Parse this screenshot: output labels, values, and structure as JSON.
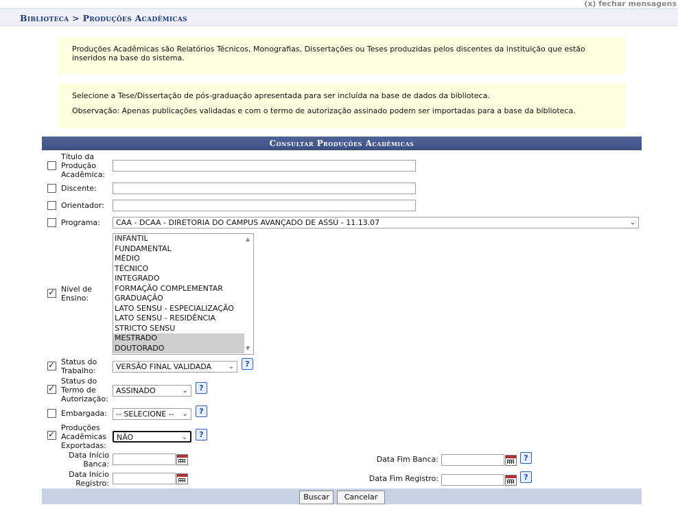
{
  "close_messages": "(x) fechar mensagens",
  "breadcrumb": {
    "root": "Biblioteca",
    "separator": ">",
    "current": "Produções Acadêmicas"
  },
  "info": {
    "paragraph1": "Produções Acadêmicas são Relatórios Técnicos, Monografias, Dissertações ou Teses produzidas pelos discentes da instituição que estão inseridos na base do sistema.",
    "paragraph2": "Selecione a Tese/Dissertação de pós-graduação apresentada para ser incluída na base de dados da biblioteca.",
    "paragraph3": "Observação: Apenas publicações validadas e com o termo de autorização assinado podem ser importadas para a base da biblioteca."
  },
  "form": {
    "caption": "Consultar Produções Acadêmicas",
    "titulo": {
      "label_l1": "Título da",
      "label_l2": "Produção",
      "label_l3": "Acadêmica:",
      "checked": false,
      "value": ""
    },
    "discente": {
      "label": "Discente:",
      "checked": false,
      "value": ""
    },
    "orientador": {
      "label": "Orientador:",
      "checked": false,
      "value": ""
    },
    "programa": {
      "label": "Programa:",
      "checked": false,
      "value": "CAA - DCAA - DIRETORIA DO CAMPUS AVANÇADO DE ASSÚ - 11.13.07"
    },
    "nivel": {
      "label_l1": "Nível de",
      "label_l2": "Ensino:",
      "checked": true,
      "options": [
        "INFANTIL",
        "FUNDAMENTAL",
        "MÉDIO",
        "TÉCNICO",
        "INTEGRADO",
        "FORMAÇÃO COMPLEMENTAR",
        "GRADUAÇÃO",
        "LATO SENSU - ESPECIALIZAÇÃO",
        "LATO SENSU - RESIDÊNCIA",
        "STRICTO SENSU",
        "MESTRADO",
        "DOUTORADO"
      ],
      "selected": [
        "MESTRADO",
        "DOUTORADO"
      ]
    },
    "status": {
      "label_l1": "Status do",
      "label_l2": "Trabalho:",
      "checked": true,
      "value": "VERSÃO FINAL VALIDADA",
      "help": "?"
    },
    "termo": {
      "label_l1": "Status do",
      "label_l2": "Termo de",
      "label_l3": "Autorização:",
      "checked": true,
      "value": "ASSINADO",
      "help": "?"
    },
    "embargada": {
      "label": "Embargada:",
      "checked": false,
      "value": "-- SELECIONE --",
      "help": "?"
    },
    "exportadas": {
      "label_l1": "Produções",
      "label_l2": "Acadêmicas",
      "label_l3": "Exportadas:",
      "checked": true,
      "value": "NÃO",
      "help": "?"
    },
    "data_inicio_banca": {
      "label_l1": "Data Início",
      "label_l2": "Banca:",
      "value": ""
    },
    "data_fim_banca": {
      "label": "Data Fim Banca:",
      "value": "",
      "help": "?"
    },
    "data_inicio_registro": {
      "label_l1": "Data Início",
      "label_l2": "Registro:",
      "value": ""
    },
    "data_fim_registro": {
      "label": "Data Fim Registro:",
      "value": "",
      "help": "?"
    },
    "buscar": "Buscar",
    "cancelar": "Cancelar"
  }
}
